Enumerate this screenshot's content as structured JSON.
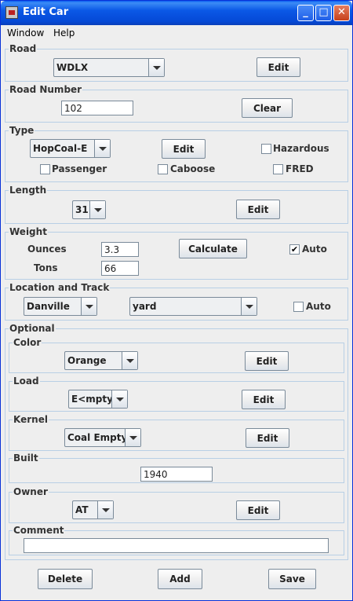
{
  "window": {
    "title": "Edit Car"
  },
  "menu": {
    "window": "Window",
    "help": "Help"
  },
  "road": {
    "label": "Road",
    "value": "WDLX",
    "edit": "Edit"
  },
  "road_number": {
    "label": "Road Number",
    "value": "102",
    "clear": "Clear"
  },
  "type": {
    "label": "Type",
    "value": "HopCoal-E",
    "edit": "Edit",
    "hazardous": "Hazardous",
    "passenger": "Passenger",
    "caboose": "Caboose",
    "fred": "FRED"
  },
  "length": {
    "label": "Length",
    "value": "31",
    "edit": "Edit"
  },
  "weight": {
    "label": "Weight",
    "ounces_label": "Ounces",
    "ounces": "3.3",
    "tons_label": "Tons",
    "tons": "66",
    "calculate": "Calculate",
    "auto": "Auto",
    "auto_checked": "✔"
  },
  "location": {
    "label": "Location and Track",
    "location": "Danville",
    "track": "yard",
    "auto": "Auto"
  },
  "optional": {
    "label": "Optional",
    "color": {
      "label": "Color",
      "value": "Orange",
      "edit": "Edit"
    },
    "load": {
      "label": "Load",
      "value": "E<mpty>",
      "edit": "Edit"
    },
    "kernel": {
      "label": "Kernel",
      "value": "Coal Empty",
      "edit": "Edit"
    },
    "built": {
      "label": "Built",
      "value": "1940"
    },
    "owner": {
      "label": "Owner",
      "value": "AT",
      "edit": "Edit"
    },
    "comment": {
      "label": "Comment",
      "value": ""
    }
  },
  "actions": {
    "delete": "Delete",
    "add": "Add",
    "save": "Save"
  }
}
